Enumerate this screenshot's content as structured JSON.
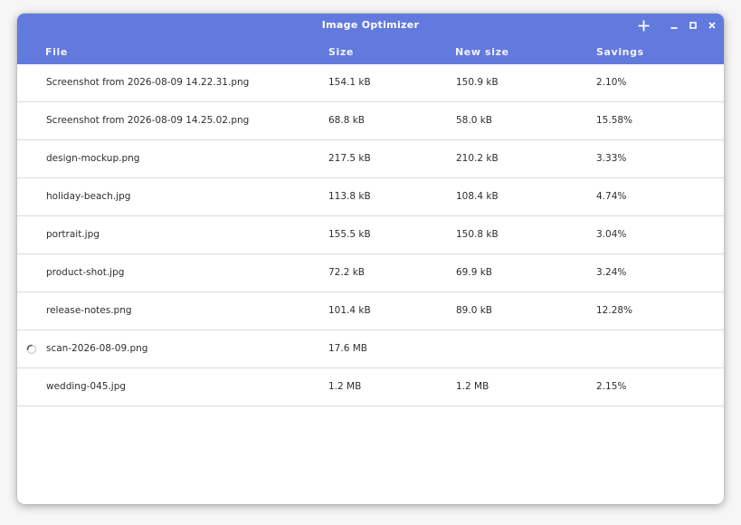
{
  "window": {
    "title": "Image Optimizer"
  },
  "header": {
    "add_icon": "plus-icon",
    "minimize_icon": "minimize-icon",
    "maximize_icon": "maximize-icon",
    "close_icon": "close-icon"
  },
  "columns": {
    "file": "File",
    "size": "Size",
    "new_size": "New size",
    "savings": "Savings"
  },
  "rows": [
    {
      "file": "Screenshot from 2026-08-09 14.22.31.png",
      "size": "154.1 kB",
      "new_size": "150.9 kB",
      "savings": "2.10%",
      "processing": false
    },
    {
      "file": "Screenshot from 2026-08-09 14.25.02.png",
      "size": "68.8 kB",
      "new_size": "58.0 kB",
      "savings": "15.58%",
      "processing": false
    },
    {
      "file": "design-mockup.png",
      "size": "217.5 kB",
      "new_size": "210.2 kB",
      "savings": "3.33%",
      "processing": false
    },
    {
      "file": "holiday-beach.jpg",
      "size": "113.8 kB",
      "new_size": "108.4 kB",
      "savings": "4.74%",
      "processing": false
    },
    {
      "file": "portrait.jpg",
      "size": "155.5 kB",
      "new_size": "150.8 kB",
      "savings": "3.04%",
      "processing": false
    },
    {
      "file": "product-shot.jpg",
      "size": "72.2 kB",
      "new_size": "69.9 kB",
      "savings": "3.24%",
      "processing": false
    },
    {
      "file": "release-notes.png",
      "size": "101.4 kB",
      "new_size": "89.0 kB",
      "savings": "12.28%",
      "processing": false
    },
    {
      "file": "scan-2026-08-09.png",
      "size": "17.6 MB",
      "new_size": "",
      "savings": "",
      "processing": true
    },
    {
      "file": "wedding-045.jpg",
      "size": "1.2 MB",
      "new_size": "1.2 MB",
      "savings": "2.15%",
      "processing": false
    }
  ],
  "colors": {
    "headerbar": "#6279dd",
    "header_text": "#ffffff",
    "row_text": "#2e2e2e",
    "divider": "#dcdcdc"
  }
}
